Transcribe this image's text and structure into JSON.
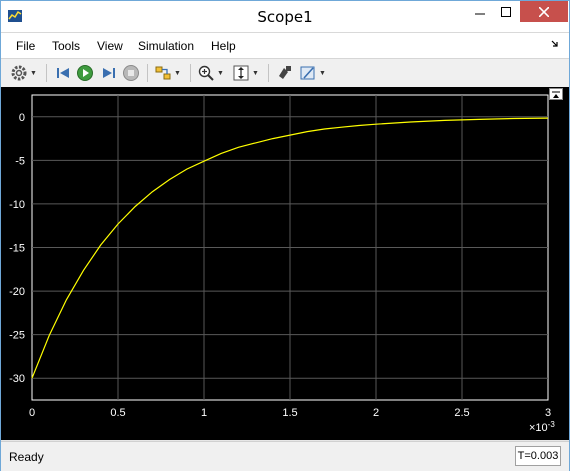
{
  "window": {
    "title": "Scope1"
  },
  "menu": {
    "items": [
      "File",
      "Tools",
      "View",
      "Simulation",
      "Help"
    ]
  },
  "toolbar": {
    "icons": [
      "settings-icon",
      "step-back-icon",
      "run-icon",
      "step-forward-icon",
      "stop-icon",
      "signal-selector-icon",
      "zoom-icon",
      "scale-axes-icon",
      "highlight-block-icon",
      "style-icon"
    ]
  },
  "chart_data": {
    "type": "line",
    "x_multiplier": "×10^-3",
    "x_exponent_label": "×10",
    "x_exponent_sup": "-3",
    "xlim": [
      0,
      3
    ],
    "ylim": [
      -32.5,
      2.5
    ],
    "xticks": [
      0,
      0.5,
      1,
      1.5,
      2,
      2.5,
      3
    ],
    "xtick_labels": [
      "0",
      "0.5",
      "1",
      "1.5",
      "2",
      "2.5",
      "3"
    ],
    "yticks": [
      0,
      -5,
      -10,
      -15,
      -20,
      -25,
      -30
    ],
    "ytick_labels": [
      "0",
      "-5",
      "-10",
      "-15",
      "-20",
      "-25",
      "-30"
    ],
    "grid": true,
    "background": "#000000",
    "axes_color": "#ffffff",
    "grid_color": "#595959",
    "series": [
      {
        "color": "#ffff00",
        "x": [
          0,
          0.1,
          0.2,
          0.3,
          0.4,
          0.5,
          0.6,
          0.7,
          0.8,
          0.9,
          1.0,
          1.1,
          1.2,
          1.3,
          1.4,
          1.5,
          1.6,
          1.7,
          1.8,
          1.9,
          2.0,
          2.2,
          2.4,
          2.6,
          2.8,
          3.0
        ],
        "y": [
          -30,
          -25.1,
          -21.0,
          -17.6,
          -14.7,
          -12.3,
          -10.3,
          -8.6,
          -7.2,
          -6.0,
          -5.1,
          -4.2,
          -3.5,
          -3.0,
          -2.5,
          -2.1,
          -1.7,
          -1.4,
          -1.2,
          -1.0,
          -0.85,
          -0.6,
          -0.42,
          -0.3,
          -0.2,
          -0.15
        ]
      }
    ]
  },
  "status": {
    "text": "Ready",
    "time": "T=0.003"
  },
  "colors": {
    "close_button": "#c7504c",
    "trace": "#ffff00"
  }
}
